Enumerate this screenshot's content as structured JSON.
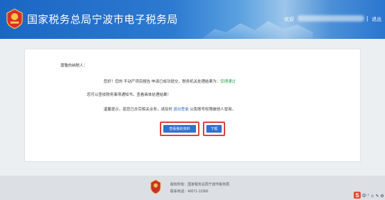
{
  "header": {
    "site_title": "国家税务总局宁波市电子税务局",
    "welcome_label": "欢迎",
    "logout_label": "退出"
  },
  "notice": {
    "salutation": "尊敬的纳税人：",
    "line1_prefix": "您好！您的 不动产项目报告 申请已成功提交，税务机关处理结果为：",
    "line1_status": "受理通过",
    "line2": "您可以查收税务事项通知书，查看具体处理结果！",
    "line3_prefix": "温馨提示，若您已办完相关业务，请及时",
    "line3_link": "退出登录",
    "line3_suffix": "以免账号权限被他人冒用。"
  },
  "buttons": {
    "view_docs": "查看我的资料",
    "download": "下载"
  },
  "footer": {
    "copyright": "版权所有：国家税务总局宁波市税务局",
    "phone": "联系电话：40071-12366"
  },
  "ime": {
    "logo": "S",
    "items": "中 ° ☺ ✎ ⚙"
  },
  "colors": {
    "header_blue": "#1b66c3",
    "button_blue": "#2d73d2",
    "highlight_red": "#e0403b",
    "status_green": "#2aa34a",
    "link_blue": "#2b6cc4"
  }
}
